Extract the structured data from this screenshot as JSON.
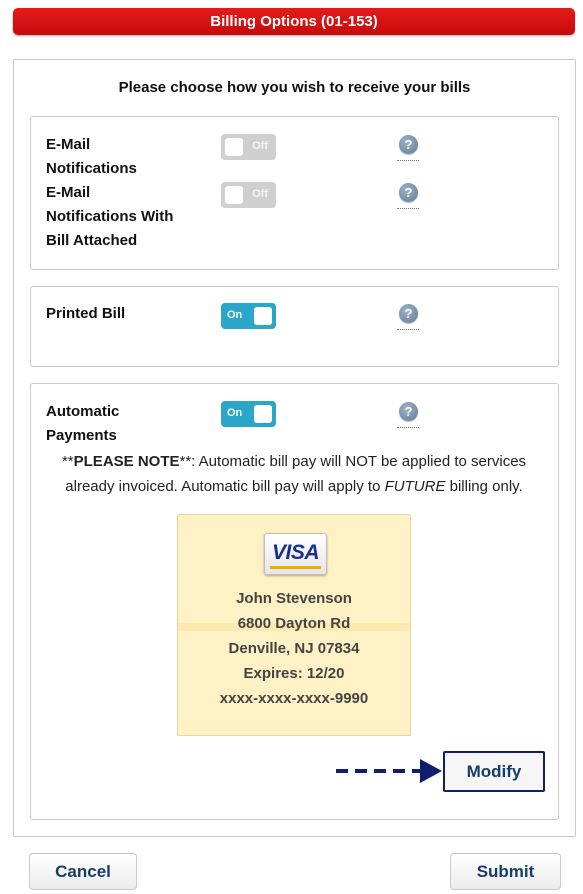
{
  "header": {
    "title": "Billing Options (01-153)"
  },
  "prompt": "Please choose how you wish to receive your bills",
  "email_section": {
    "email": {
      "label_lines": [
        "E-Mail",
        "Notifications"
      ],
      "state": "Off",
      "help": "?"
    },
    "email_attached": {
      "label_lines": [
        "E-Mail",
        "Notifications With",
        "Bill Attached"
      ],
      "state": "Off",
      "help": "?"
    }
  },
  "printed_section": {
    "printed": {
      "label": "Printed Bill",
      "state": "On",
      "help": "?"
    }
  },
  "autopay_section": {
    "autopay": {
      "label_lines": [
        "Automatic",
        "Payments"
      ],
      "state": "On",
      "help": "?"
    },
    "note": {
      "prefix": "**",
      "bold": "PLEASE NOTE",
      "after_bold": "**: Automatic bill pay will NOT be applied to services already invoiced. Automatic bill pay will apply to ",
      "italic": "FUTURE",
      "suffix": " billing only."
    },
    "card": {
      "brand": "VISA",
      "name": "John Stevenson",
      "address": "6800 Dayton Rd",
      "city": "Denville, NJ 07834",
      "expires": "Expires: 12/20",
      "number": "xxxx-xxxx-xxxx-9990"
    },
    "modify_label": "Modify"
  },
  "footer": {
    "cancel_label": "Cancel",
    "submit_label": "Submit"
  },
  "colors": {
    "header": "#d10f0f",
    "toggle_on": "#2aa6c9",
    "toggle_off": "#cfcfcf",
    "button_text": "#163e6b",
    "card_bg": "#fdf1c5",
    "arrow": "#0f1e6d"
  }
}
